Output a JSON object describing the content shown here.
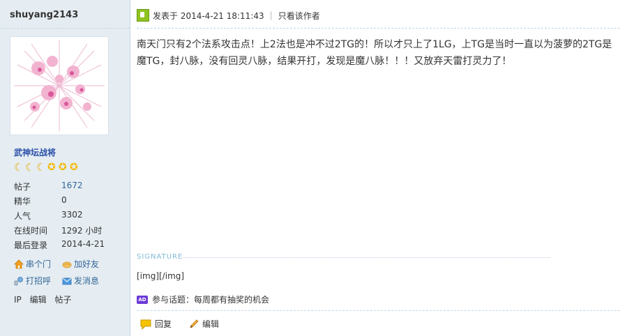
{
  "user": {
    "name": "shuyang2143",
    "rank": "武神坛战将",
    "stats": [
      {
        "key": "帖子",
        "value": "1672"
      },
      {
        "key": "精华",
        "value": "0"
      },
      {
        "key": "人气",
        "value": "3302"
      },
      {
        "key": "在线时间",
        "value": "1292 小时"
      },
      {
        "key": "最后登录",
        "value": "2014-4-21"
      }
    ],
    "actions": {
      "visit": "串个门",
      "add_friend": "加好友",
      "greet": "打招呼",
      "message": "发消息"
    },
    "bottom_links": [
      "IP",
      "编辑",
      "帖子"
    ]
  },
  "post": {
    "posted_at": "发表于 2014-4-21 18:11:43",
    "only_author": "只看该作者",
    "content": "南天门只有2个法系攻击点！上2法也是冲不过2TG的！所以才只上了1LG，上TG是当时一直以为菠萝的2TG是魔TG，封八脉，没有回灵八脉，结果开打，发现是魔八脉！！！又放弃天雷打灵力了！",
    "signature_label": "SIGNATURE",
    "signature_text": "[img][/img]",
    "ad_badge": "AD",
    "topic_text": "参与话题：每周都有抽奖的机会",
    "reply": "回复",
    "edit": "编辑"
  }
}
